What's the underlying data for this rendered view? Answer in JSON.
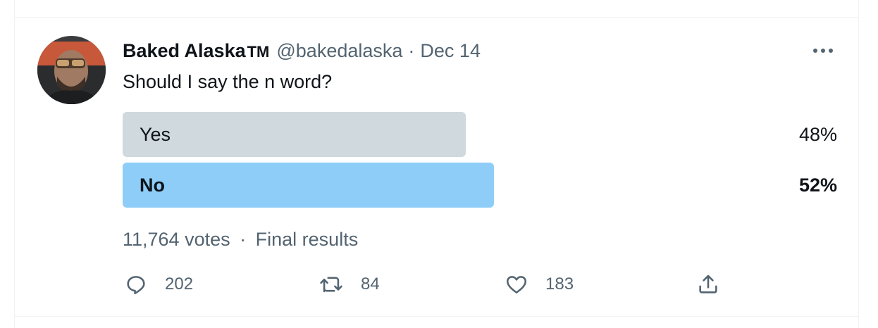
{
  "tweet": {
    "author": {
      "display_name": "Baked Alaska",
      "badge": "TM",
      "handle": "@bakedalaska"
    },
    "separator": "·",
    "date": "Dec 14",
    "text": "Should I say the n word?",
    "poll": {
      "options": [
        {
          "label": "Yes",
          "percent_text": "48%",
          "bar_fraction": 0.48,
          "color": "#cfd9de",
          "winner": false
        },
        {
          "label": "No",
          "percent_text": "52%",
          "bar_fraction": 0.52,
          "color": "#8ecdf8",
          "winner": true
        }
      ],
      "votes": "11,764 votes",
      "status": "Final results"
    },
    "actions": {
      "replies": "202",
      "retweets": "84",
      "likes": "183"
    }
  },
  "icons": {
    "more": "more-horizontal-icon",
    "reply": "reply-icon",
    "retweet": "retweet-icon",
    "like": "heart-icon",
    "share": "share-icon"
  },
  "colors": {
    "text_primary": "#0f1419",
    "text_secondary": "#536471",
    "poll_loser": "#cfd9de",
    "poll_winner": "#8ecdf8",
    "border": "#eff3f4"
  }
}
